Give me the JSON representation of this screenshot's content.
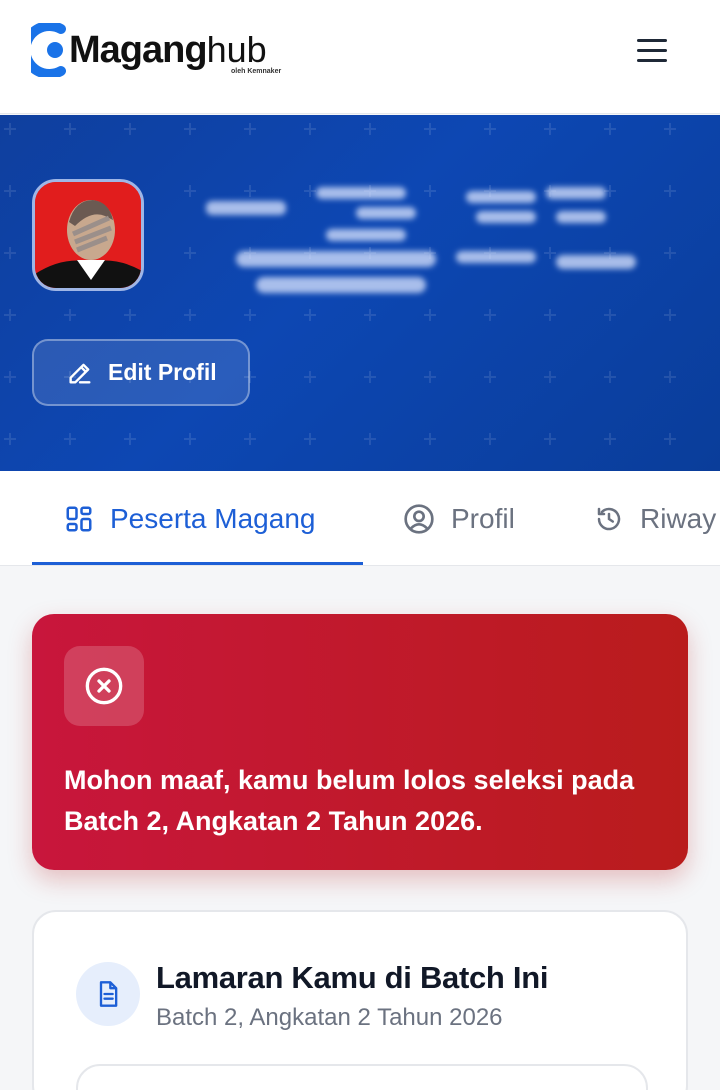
{
  "header": {
    "logo_main": "Maganghub",
    "logo_main_bold": "Magang",
    "logo_main_light": "hub",
    "logo_tagline": "oleh Kemnaker",
    "menu_icon": "hamburger-menu-icon"
  },
  "hero": {
    "edit_label": "Edit Profil",
    "edit_icon": "pencil-icon",
    "avatar_icon": "user-avatar"
  },
  "tabs": [
    {
      "label": "Peserta Magang",
      "icon": "grid-icon",
      "active": true
    },
    {
      "label": "Profil",
      "icon": "user-circle-icon",
      "active": false
    },
    {
      "label": "Riway",
      "icon": "history-icon",
      "active": false
    }
  ],
  "alert": {
    "icon": "x-circle-icon",
    "message": "Mohon maaf, kamu belum lolos seleksi pada Batch 2, Angkatan 2 Tahun 2026."
  },
  "card": {
    "icon": "document-icon",
    "title": "Lamaran Kamu di Batch Ini",
    "subtitle": "Batch 2, Angkatan 2 Tahun 2026"
  },
  "colors": {
    "brand_blue": "#1d5fd6",
    "hero_blue": "#0d47b3",
    "alert_red": "#c01b2f"
  }
}
